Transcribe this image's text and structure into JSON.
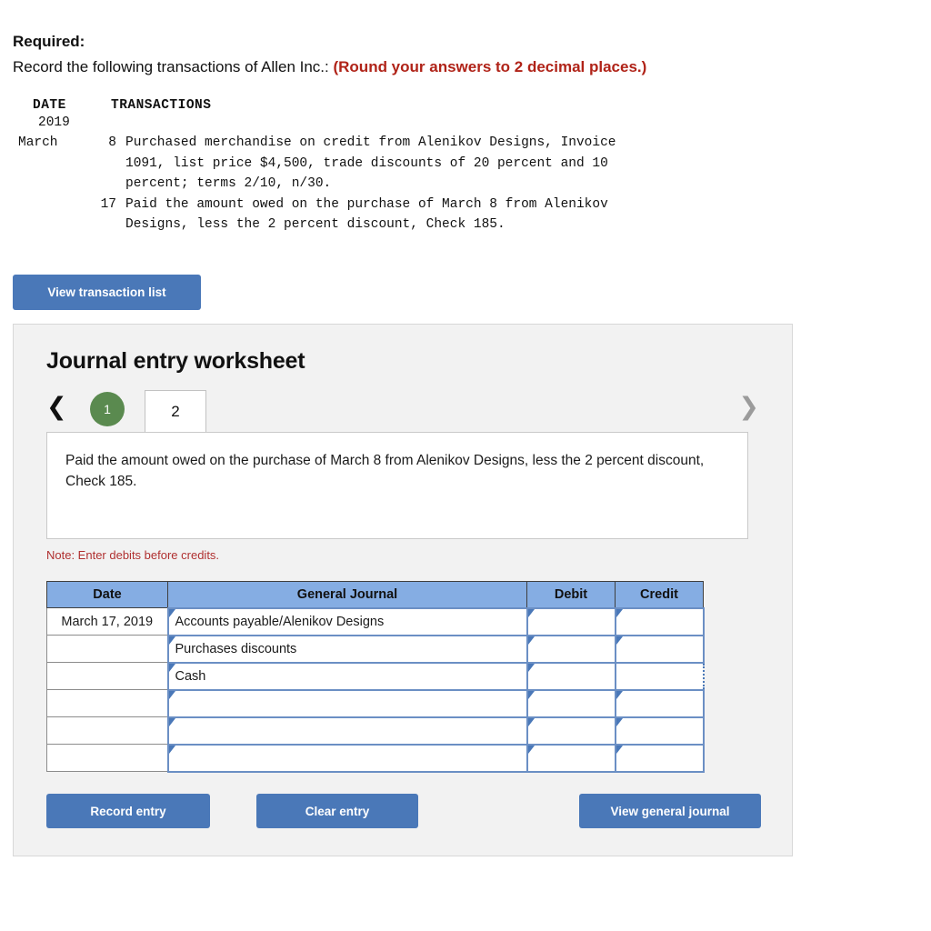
{
  "required": {
    "label": "Required:",
    "instruction": "Record the following transactions of Allen Inc.:",
    "round_note": "(Round your answers to 2 decimal places.)"
  },
  "transaction_table": {
    "header_date": "DATE",
    "header_transactions": "TRANSACTIONS",
    "year": "2019",
    "rows": [
      {
        "month": "March",
        "day": "8",
        "line1": "Purchased merchandise on credit from Alenikov Designs, Invoice",
        "line2": "1091, list price $4,500, trade discounts of 20 percent and 10",
        "line3": "percent; terms 2/10, n/30."
      },
      {
        "month": "",
        "day": "17",
        "line1": "Paid the amount owed on the purchase of March 8 from Alenikov",
        "line2": "Designs, less the 2 percent discount, Check 185.",
        "line3": ""
      }
    ]
  },
  "view_transaction_list_label": "View transaction list",
  "worksheet": {
    "title": "Journal entry worksheet",
    "tabs": {
      "prev_icon": "chevron-left",
      "next_icon": "chevron-right",
      "completed_tab": "1",
      "active_tab": "2"
    },
    "prompt": "Paid the amount owed on the purchase of March 8 from Alenikov Designs, less the 2 percent discount, Check 185.",
    "note": "Note: Enter debits before credits.",
    "columns": [
      "Date",
      "General Journal",
      "Debit",
      "Credit"
    ],
    "rows": [
      {
        "date": "March 17, 2019",
        "account": "Accounts payable/Alenikov Designs",
        "debit": "",
        "credit": "",
        "credit_focused": false
      },
      {
        "date": "",
        "account": "Purchases discounts",
        "debit": "",
        "credit": "",
        "credit_focused": false
      },
      {
        "date": "",
        "account": "Cash",
        "debit": "",
        "credit": "",
        "credit_focused": true
      },
      {
        "date": "",
        "account": "",
        "debit": "",
        "credit": "",
        "credit_focused": false
      },
      {
        "date": "",
        "account": "",
        "debit": "",
        "credit": "",
        "credit_focused": false
      },
      {
        "date": "",
        "account": "",
        "debit": "",
        "credit": "",
        "credit_focused": false
      }
    ],
    "buttons": {
      "record": "Record entry",
      "clear": "Clear entry",
      "journal": "View general journal"
    }
  },
  "colors": {
    "button_blue": "#4a78b8",
    "header_blue": "#85ade3",
    "input_border_blue": "#6b8fc4",
    "completed_green": "#5a8a4f",
    "note_red": "#b03030",
    "accent_red": "#b02318",
    "panel_gray": "#f2f2f2"
  }
}
